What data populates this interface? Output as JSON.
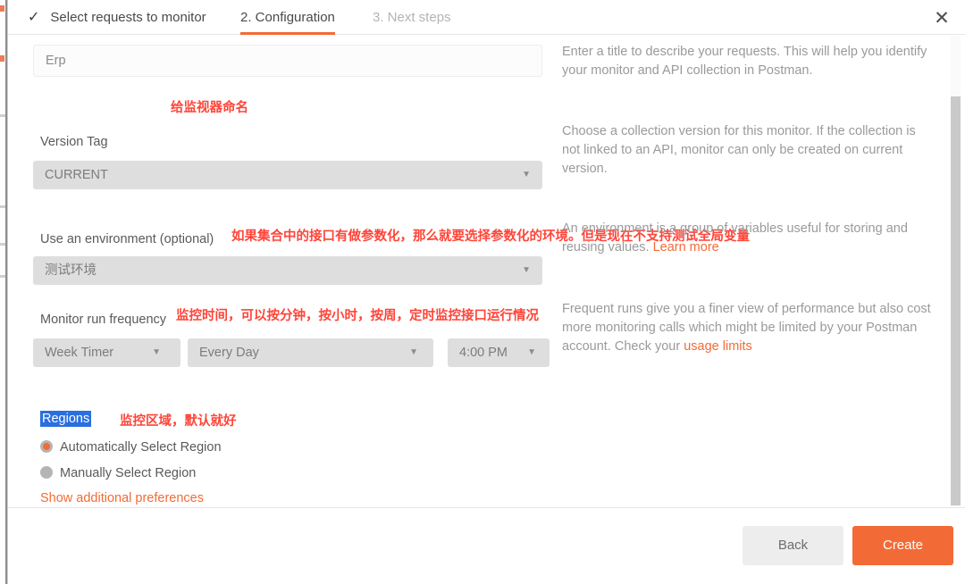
{
  "wizard": {
    "tabs": [
      {
        "label": "Select requests to monitor",
        "state": "completed",
        "icon": "check-icon"
      },
      {
        "label": "2. Configuration",
        "state": "active"
      },
      {
        "label": "3. Next steps",
        "state": "upcoming"
      }
    ],
    "close_icon": "✕"
  },
  "form": {
    "name": {
      "value": "Erp",
      "placeholder": "Erp"
    },
    "version": {
      "label": "Version Tag",
      "value": "CURRENT"
    },
    "environment": {
      "label": "Use an environment (optional)",
      "value": "测试环境"
    },
    "frequency": {
      "label": "Monitor run frequency",
      "unit_value": "Week Timer",
      "day_value": "Every Day",
      "time_value": "4:00 PM"
    },
    "regions": {
      "label": "Regions",
      "options": [
        {
          "label": "Automatically Select Region",
          "selected": true
        },
        {
          "label": "Manually Select Region",
          "selected": false
        }
      ],
      "show_additional_label": "Show additional preferences"
    },
    "caret_glyph": "▼"
  },
  "help": {
    "name": "Enter a title to describe your requests. This will help you identify your monitor and API collection in Postman.",
    "version": "Choose a collection version for this monitor. If the collection is not linked to an API, monitor can only be created on current version.",
    "environment_text": "An environment is a group of variables useful for storing and reusing values. ",
    "environment_link": "Learn more",
    "frequency_text": "Frequent runs give you a finer view of performance but also cost more monitoring calls which might be limited by your Postman account. Check your ",
    "frequency_link": "usage limits"
  },
  "annotations": {
    "name": "给监视器命名",
    "environment": "如果集合中的接口有做参数化，那么就要选择参数化的环境。但是现在不支持测试全局变量",
    "frequency": "监控时间，可以按分钟，按小时，按周，定时监控接口运行情况",
    "regions": "监控区域，默认就好"
  },
  "footer": {
    "back_label": "Back",
    "create_label": "Create"
  },
  "colors": {
    "accent": "#f26b36",
    "annotation": "#ff4438",
    "selection_highlight": "#2a6fe0",
    "help_text": "#9a9a9a"
  }
}
